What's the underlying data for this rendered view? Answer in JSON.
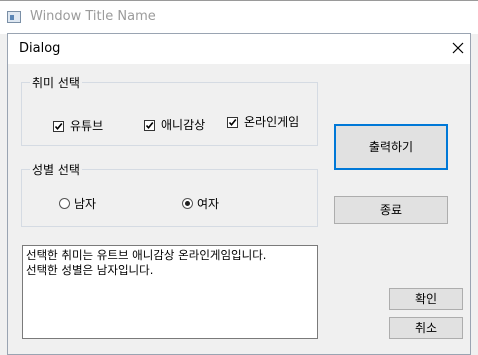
{
  "window": {
    "title": "Window Title Name"
  },
  "dialog": {
    "title": "Dialog",
    "hobby_group": {
      "legend": "취미 선택",
      "options": [
        {
          "label": "유튜브",
          "checked": true
        },
        {
          "label": "애니감상",
          "checked": true
        },
        {
          "label": "온라인게임",
          "checked": true
        }
      ]
    },
    "gender_group": {
      "legend": "성별 선택",
      "options": [
        {
          "label": "남자",
          "selected": false
        },
        {
          "label": "여자",
          "selected": true
        }
      ]
    },
    "buttons": {
      "print": "출력하기",
      "exit": "종료",
      "ok": "확인",
      "cancel": "취소"
    },
    "output_lines": [
      "선택한 취미는 유트브 애니감상 온라인게임입니다.",
      "선택한 성별은 남자입니다."
    ],
    "icons": {
      "window_icon": "window-app-icon",
      "close": "close-icon",
      "check": "checkmark-icon",
      "radio": "radio-dot-icon"
    }
  }
}
